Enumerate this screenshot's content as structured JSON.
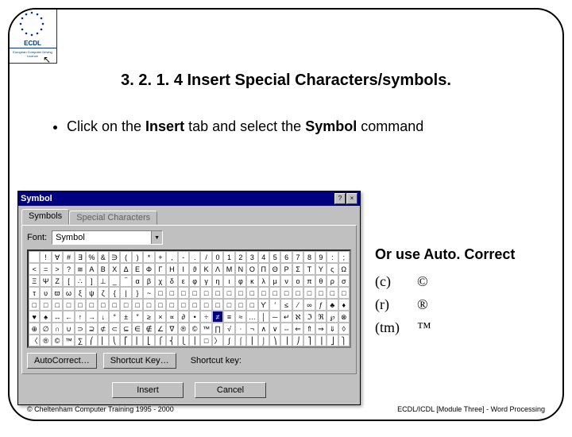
{
  "logo": {
    "acronym": "ECDL",
    "subtitle": "European Computer Driving Licence"
  },
  "title": "3. 2. 1. 4 Insert Special Characters/symbols.",
  "instruction": {
    "pre": "Click on the ",
    "b1": "Insert",
    "mid": " tab and select the ",
    "b2": "Symbol",
    "post": " command"
  },
  "dialog": {
    "title": "Symbol",
    "help": "?",
    "close": "×",
    "tabs": {
      "active": "Symbols",
      "other": "Special Characters"
    },
    "font_label": "Font:",
    "font_value": "Symbol",
    "buttons": {
      "ac": "AutoCorrect…",
      "sk": "Shortcut Key…",
      "sk_label": "Shortcut key:",
      "insert": "Insert",
      "cancel": "Cancel"
    },
    "grid_rows": [
      [
        " ",
        "!",
        "∀",
        "#",
        "∃",
        "%",
        "&",
        "∋",
        "(",
        ")",
        "*",
        "+",
        ",",
        "-",
        ".",
        "/",
        "0",
        "1",
        "2",
        "3",
        "4",
        "5",
        "6",
        "7",
        "8",
        "9",
        ":",
        ";"
      ],
      [
        "<",
        "=",
        ">",
        "?",
        "≅",
        "Α",
        "Β",
        "Χ",
        "Δ",
        "Ε",
        "Φ",
        "Γ",
        "Η",
        "Ι",
        "ϑ",
        "Κ",
        "Λ",
        "Μ",
        "Ν",
        "Ο",
        "Π",
        "Θ",
        "Ρ",
        "Σ",
        "Τ",
        "Υ",
        "ς",
        "Ω"
      ],
      [
        "Ξ",
        "Ψ",
        "Ζ",
        "[",
        "∴",
        "]",
        "⊥",
        "_",
        "‾",
        "α",
        "β",
        "χ",
        "δ",
        "ε",
        "φ",
        "γ",
        "η",
        "ι",
        "φ",
        "κ",
        "λ",
        "μ",
        "ν",
        "ο",
        "π",
        "θ",
        "ρ",
        "σ"
      ],
      [
        "τ",
        "υ",
        "ϖ",
        "ω",
        "ξ",
        "ψ",
        "ζ",
        "{",
        "|",
        "}",
        "~",
        "□",
        "□",
        "□",
        "□",
        "□",
        "□",
        "□",
        "□",
        "□",
        "□",
        "□",
        "□",
        "□",
        "□",
        "□",
        "□",
        "□"
      ],
      [
        "□",
        "□",
        "□",
        "□",
        "□",
        "□",
        "□",
        "□",
        "□",
        "□",
        "□",
        "□",
        "□",
        "□",
        "□",
        "□",
        "□",
        "□",
        "□",
        "□",
        "ϒ",
        "′",
        "≤",
        "⁄",
        "∞",
        "ƒ",
        "♣",
        "♦"
      ],
      [
        "♥",
        "♠",
        "↔",
        "←",
        "↑",
        "→",
        "↓",
        "°",
        "±",
        "″",
        "≥",
        "×",
        "∝",
        "∂",
        "•",
        "÷",
        "≠",
        "≡",
        "≈",
        "…",
        "│",
        "─",
        "↵",
        "ℵ",
        "ℑ",
        "ℜ",
        "℘",
        "⊗"
      ],
      [
        "⊕",
        "∅",
        "∩",
        "∪",
        "⊃",
        "⊇",
        "⊄",
        "⊂",
        "⊆",
        "∈",
        "∉",
        "∠",
        "∇",
        "®",
        "©",
        "™",
        "∏",
        "√",
        "⋅",
        "¬",
        "∧",
        "∨",
        "⇔",
        "⇐",
        "⇑",
        "⇒",
        "⇓",
        "◊"
      ],
      [
        "〈",
        "®",
        "©",
        "™",
        "∑",
        "⎛",
        "⎜",
        "⎝",
        "⎡",
        "⎢",
        "⎣",
        "⎧",
        "⎨",
        "⎩",
        "⎪",
        "□",
        "〉",
        "∫",
        "⌠",
        "⎮",
        "⌡",
        "⎞",
        "⎟",
        "⎠",
        "⎤",
        "⎥",
        "⎦",
        "⎫"
      ]
    ],
    "selected": {
      "row": 5,
      "col": 16
    }
  },
  "side": {
    "heading": "Or use Auto. Correct",
    "rows": [
      {
        "in": "(c)",
        "out": "©"
      },
      {
        "in": "(r)",
        "out": "®"
      },
      {
        "in": "(tm)",
        "out": "™"
      }
    ]
  },
  "footer": {
    "left": "© Cheltenham Computer Training 1995 - 2000",
    "right": "ECDL/ICDL [Module Three]  - Word Processing"
  }
}
